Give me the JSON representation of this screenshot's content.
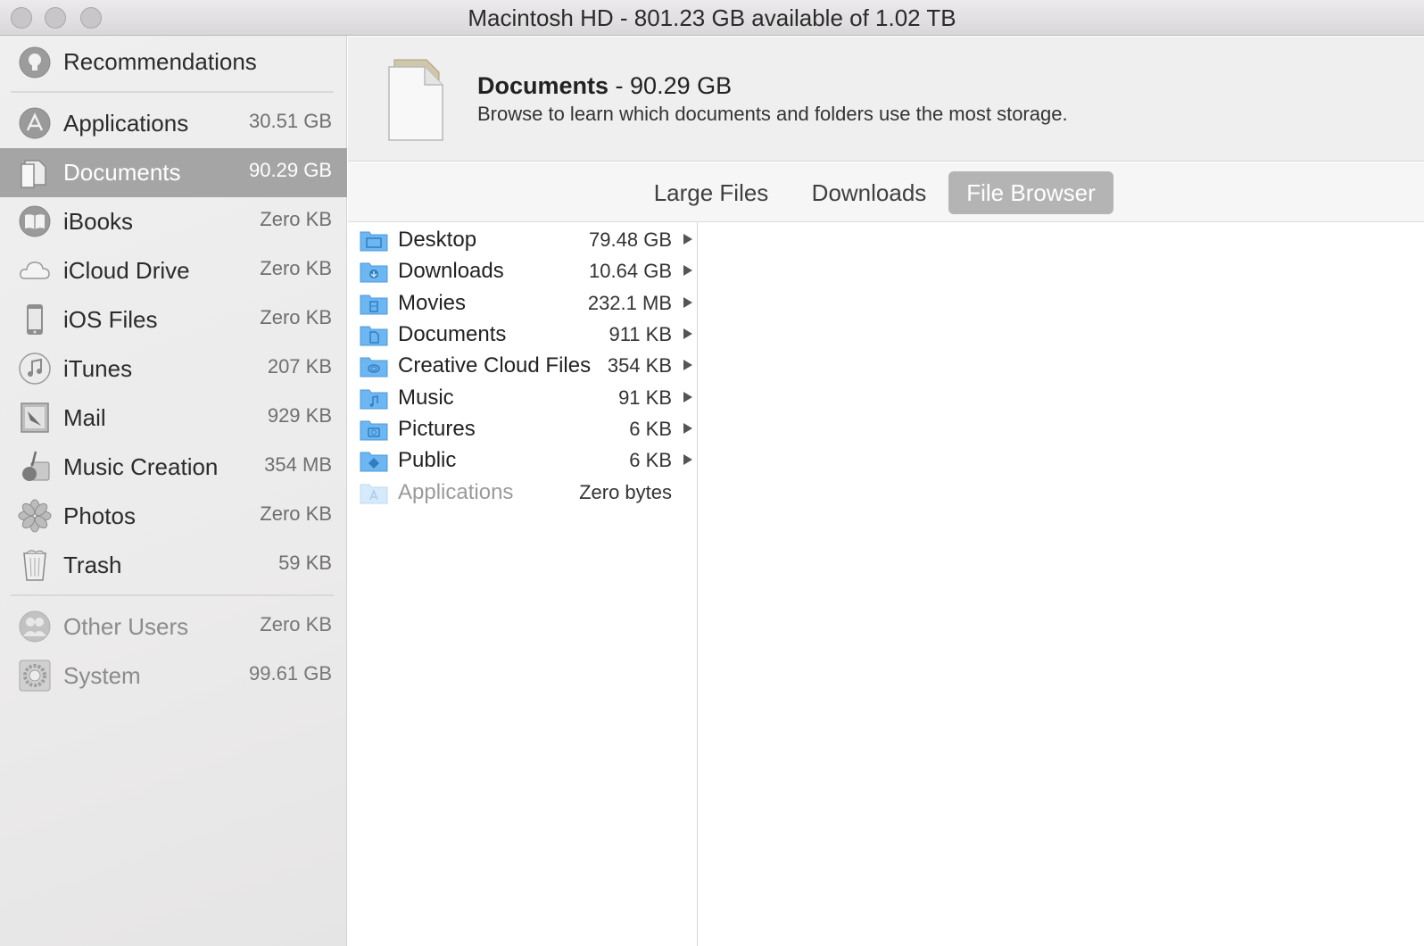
{
  "window": {
    "title": "Macintosh HD - 801.23 GB available of 1.02 TB"
  },
  "sidebar": {
    "top": {
      "label": "Recommendations",
      "icon": "lightbulb-icon"
    },
    "items": [
      {
        "label": "Applications",
        "size": "30.51 GB",
        "icon": "app-store-icon"
      },
      {
        "label": "Documents",
        "size": "90.29 GB",
        "icon": "document-icon",
        "selected": true
      },
      {
        "label": "iBooks",
        "size": "Zero KB",
        "icon": "book-icon"
      },
      {
        "label": "iCloud Drive",
        "size": "Zero KB",
        "icon": "cloud-icon"
      },
      {
        "label": "iOS Files",
        "size": "Zero KB",
        "icon": "iphone-icon"
      },
      {
        "label": "iTunes",
        "size": "207 KB",
        "icon": "music-note-icon"
      },
      {
        "label": "Mail",
        "size": "929 KB",
        "icon": "mail-stamp-icon"
      },
      {
        "label": "Music Creation",
        "size": "354 MB",
        "icon": "guitar-icon"
      },
      {
        "label": "Photos",
        "size": "Zero KB",
        "icon": "photos-flower-icon"
      },
      {
        "label": "Trash",
        "size": "59 KB",
        "icon": "trash-icon"
      }
    ],
    "bottom": [
      {
        "label": "Other Users",
        "size": "Zero KB",
        "icon": "users-icon"
      },
      {
        "label": "System",
        "size": "99.61 GB",
        "icon": "gear-icon"
      }
    ]
  },
  "header": {
    "title": "Documents",
    "separator": " - ",
    "size": "90.29 GB",
    "subtitle": "Browse to learn which documents and folders use the most storage."
  },
  "tabs": [
    {
      "label": "Large Files",
      "active": false
    },
    {
      "label": "Downloads",
      "active": false
    },
    {
      "label": "File Browser",
      "active": true
    }
  ],
  "files": [
    {
      "name": "Desktop",
      "size": "79.48 GB",
      "icon": "desktop-folder-icon",
      "expandable": true
    },
    {
      "name": "Downloads",
      "size": "10.64 GB",
      "icon": "downloads-folder-icon",
      "expandable": true
    },
    {
      "name": "Movies",
      "size": "232.1 MB",
      "icon": "movies-folder-icon",
      "expandable": true
    },
    {
      "name": "Documents",
      "size": "911 KB",
      "icon": "documents-folder-icon",
      "expandable": true
    },
    {
      "name": "Creative Cloud Files",
      "size": "354 KB",
      "icon": "creative-cloud-folder-icon",
      "expandable": true
    },
    {
      "name": "Music",
      "size": "91 KB",
      "icon": "music-folder-icon",
      "expandable": true
    },
    {
      "name": "Pictures",
      "size": "6 KB",
      "icon": "pictures-folder-icon",
      "expandable": true
    },
    {
      "name": "Public",
      "size": "6 KB",
      "icon": "public-folder-icon",
      "expandable": true
    },
    {
      "name": "Applications",
      "size": "Zero bytes",
      "icon": "applications-folder-icon",
      "expandable": false
    }
  ],
  "colors": {
    "selection": "#a6a5a6",
    "active_tab": "#b4b4b4",
    "folder_blue": "#6db6f2"
  }
}
